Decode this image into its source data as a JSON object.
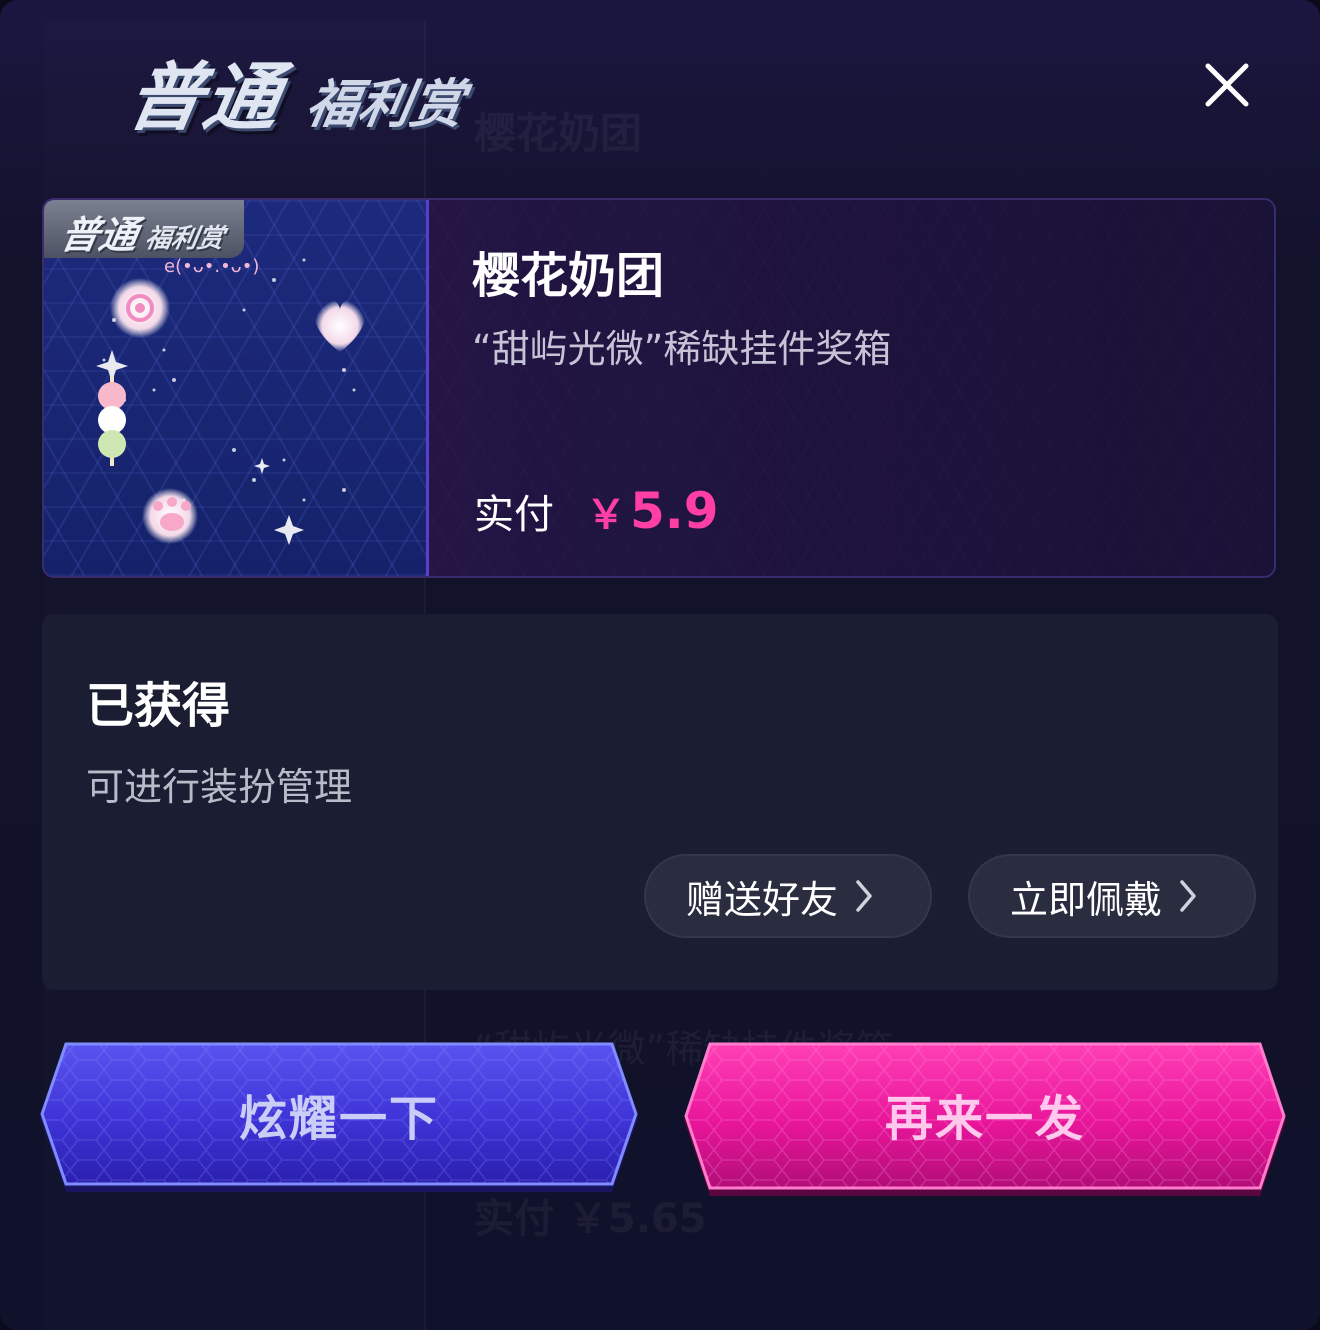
{
  "header": {
    "logo_big": "普通",
    "logo_small": "福利赏",
    "close_icon": "close-icon"
  },
  "product": {
    "tag_big": "普通",
    "tag_small": "福利赏",
    "thumb_caption": "e(•ᴗ•.•ᴗ•)",
    "name": "樱花奶团",
    "description": "“甜屿光微”稀缺挂件奖箱",
    "price_label": "实付",
    "price_currency": "￥",
    "price_value": "5.9"
  },
  "status": {
    "title": "已获得",
    "subtitle": "可进行装扮管理",
    "gift_button": "赠送好友",
    "wear_button": "立即佩戴"
  },
  "actions": {
    "show_off": "炫耀一下",
    "again": "再来一发"
  },
  "background_ghost": {
    "name": "樱花奶团",
    "description": "“甜屿光微”稀缺挂件奖箱",
    "price": "实付  ￥5.65"
  },
  "colors": {
    "accent_pink": "#ff3fa4",
    "button_blue": "#3c36d8",
    "button_magenta": "#e8159a",
    "panel": "#1b1e33"
  }
}
